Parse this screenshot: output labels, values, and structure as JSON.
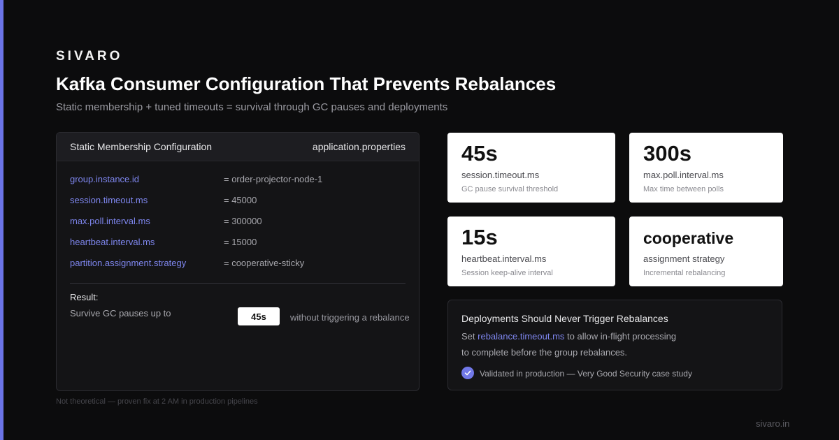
{
  "brand": "SIVARO",
  "title": "Kafka Consumer Configuration That Prevents Rebalances",
  "subtitle": "Static membership + tuned timeouts = survival through GC pauses and deployments",
  "config_panel": {
    "header_title": "Static Membership Configuration",
    "header_file": "application.properties",
    "rows": [
      {
        "key": "group.instance.id",
        "value": "= order-projector-node-1"
      },
      {
        "key": "session.timeout.ms",
        "value": "= 45000"
      },
      {
        "key": "max.poll.interval.ms",
        "value": "= 300000"
      },
      {
        "key": "heartbeat.interval.ms",
        "value": "= 15000"
      },
      {
        "key": "partition.assignment.strategy",
        "value": "= cooperative-sticky"
      }
    ],
    "result_label": "Result:",
    "result_text": "Survive GC pauses up to",
    "result_badge": "45s",
    "result_suffix": "without triggering a rebalance"
  },
  "stats": [
    {
      "value": "45s",
      "name": "session.timeout.ms",
      "desc": "GC pause survival threshold"
    },
    {
      "value": "300s",
      "name": "max.poll.interval.ms",
      "desc": "Max time between polls"
    },
    {
      "value": "15s",
      "name": "heartbeat.interval.ms",
      "desc": "Session keep-alive interval"
    },
    {
      "value": "cooperative",
      "name": "assignment strategy",
      "desc": "Incremental rebalancing"
    }
  ],
  "deploy_panel": {
    "title": "Deployments Should Never Trigger Rebalances",
    "line1_prefix": "Set",
    "line1_key": "rebalance.timeout.ms",
    "line1_suffix": "to allow in-flight processing",
    "line2": "to complete before the group rebalances.",
    "validated": "Validated in production — Very Good Security case study"
  },
  "footnote": "Not theoretical — proven fix at 2 AM in production pipelines",
  "site": "sivaro.in",
  "colors": {
    "accent": "#6b74e6",
    "key_text": "#7e86ee",
    "background": "#0c0c0d"
  }
}
